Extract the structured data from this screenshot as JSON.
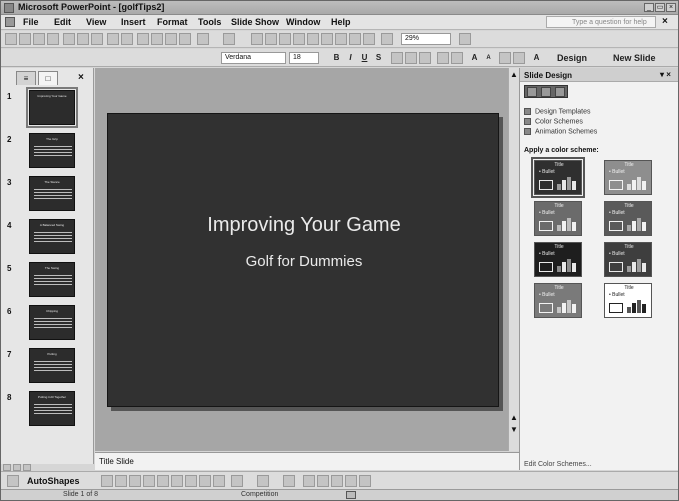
{
  "window": {
    "title": "Microsoft PowerPoint - [golfTips2]"
  },
  "menu": [
    "File",
    "Edit",
    "View",
    "Insert",
    "Format",
    "Tools",
    "Slide Show",
    "Window",
    "Help"
  ],
  "help_search": {
    "placeholder": "Type a question for help"
  },
  "toolbar": {
    "zoom": "29%",
    "font": "Verdana",
    "size": "18",
    "design_label": "Design",
    "new_slide_label": "New Slide"
  },
  "left_panel": {
    "thumbnails": [
      {
        "num": "1",
        "text": "Improving Your Game",
        "selected": true
      },
      {
        "num": "2",
        "text": "The Grip"
      },
      {
        "num": "3",
        "text": "The Stance"
      },
      {
        "num": "4",
        "text": "A Balanced Swing"
      },
      {
        "num": "5",
        "text": "The Swing"
      },
      {
        "num": "6",
        "text": "Chipping"
      },
      {
        "num": "7",
        "text": "Putting"
      },
      {
        "num": "8",
        "text": "Putting it All Together"
      }
    ]
  },
  "slide": {
    "title": "Improving Your Game",
    "subtitle": "Golf for Dummies"
  },
  "notes": {
    "text": "Title Slide"
  },
  "task_pane": {
    "title": "Slide Design",
    "links": [
      "Design Templates",
      "Color Schemes",
      "Animation Schemes"
    ],
    "section_label": "Apply a color scheme:",
    "scheme_title": "Title",
    "scheme_bullet": "• Bullet",
    "schemes": [
      {
        "bg": "#2f2f2f",
        "fg": "#e8e8e8",
        "accent": "#9a9a9a",
        "selected": true
      },
      {
        "bg": "#8e8e8e",
        "fg": "#f2f2f2",
        "accent": "#dcdcdc"
      },
      {
        "bg": "#6b6b6b",
        "fg": "#f2f2f2",
        "accent": "#bcbcbc"
      },
      {
        "bg": "#5a5a5a",
        "fg": "#f2f2f2",
        "accent": "#a8a8a8"
      },
      {
        "bg": "#1e1e1e",
        "fg": "#e8e8e8",
        "accent": "#8a8a8a"
      },
      {
        "bg": "#3e3e3e",
        "fg": "#e8e8e8",
        "accent": "#9c9c9c"
      },
      {
        "bg": "#7a7a7a",
        "fg": "#f2f2f2",
        "accent": "#c6c6c6"
      },
      {
        "bg": "#ffffff",
        "fg": "#222222",
        "accent": "#555555"
      }
    ],
    "footer_link": "Edit Color Schemes..."
  },
  "drawing_toolbar": {
    "autoshapes_label": "AutoShapes"
  },
  "status": {
    "slide_info": "Slide 1 of 8",
    "design_name": "Competition"
  }
}
